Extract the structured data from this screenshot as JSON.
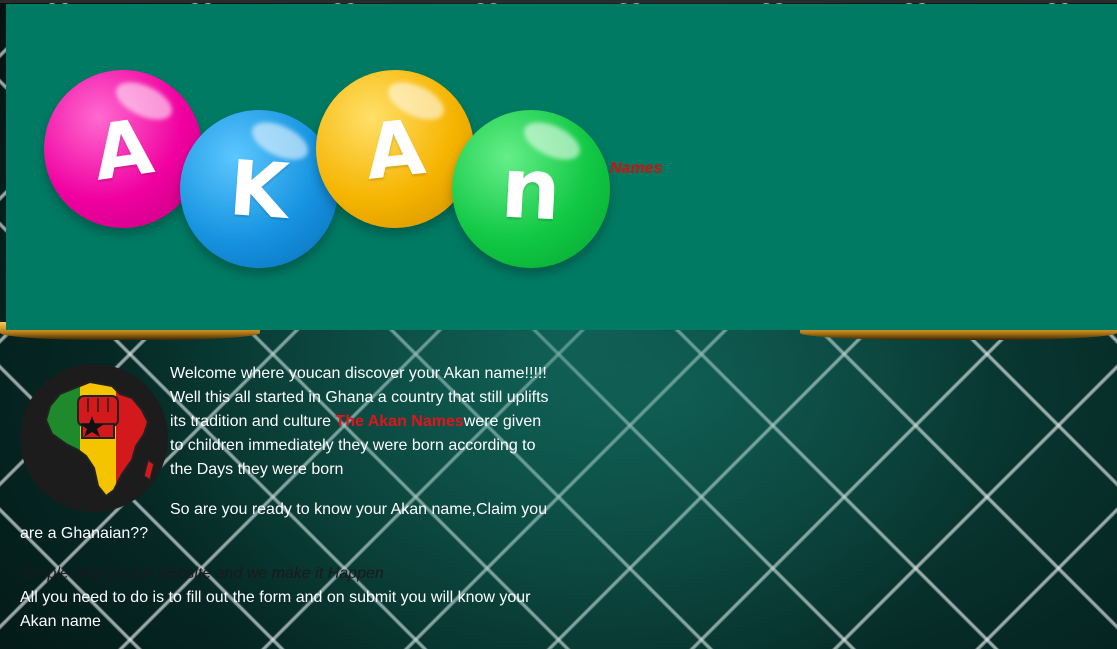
{
  "header": {
    "logo_letters": [
      "A",
      "K",
      "A",
      "n"
    ],
    "logo_colors": [
      "#f000a0",
      "#1693e0",
      "#f6b400",
      "#10c843"
    ],
    "subtitle": "Names",
    "background": "#007a63"
  },
  "intro": {
    "welcome_text": "Welcome where youcan discover your Akan name!!!!! Well this all started in Ghana a country that still uplifts its tradition and culture ",
    "highlight_text": "The Akan Names",
    "after_highlight_text": "were given to children immediately they were born according to the Days they were born",
    "question_text": "So are you ready to know your Akan name,Claim you are a Ghanaian??",
    "tagline": "Simple only on our website and we make it Happen",
    "instructions": "All you need to do is to fill out the form and on submit you will know your Akan name"
  },
  "badge": {
    "icon": "africa-fist-icon"
  }
}
